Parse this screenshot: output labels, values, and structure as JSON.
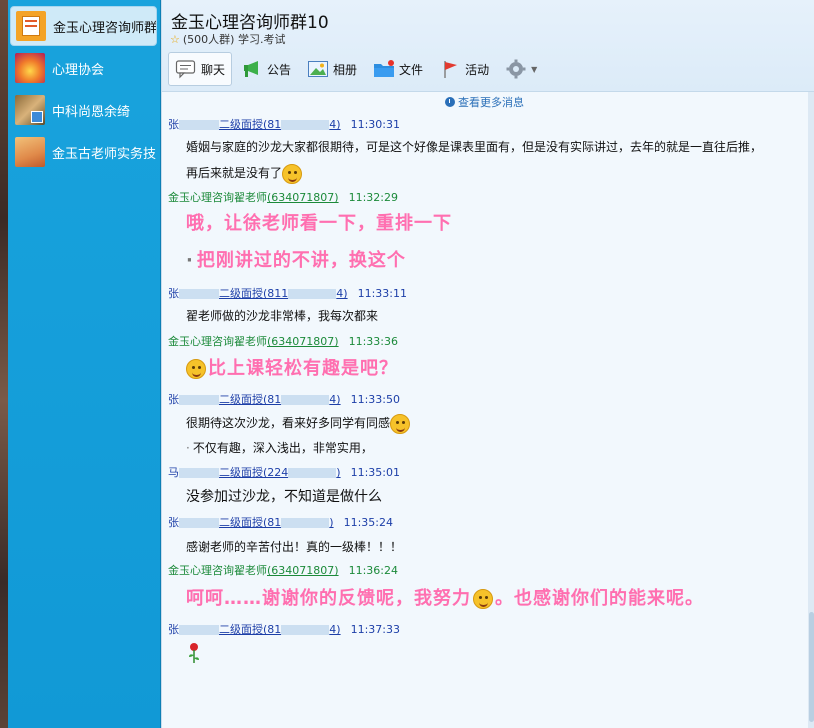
{
  "sidebar": {
    "groups": [
      {
        "name": "金玉心理咨询师群10",
        "active": true
      },
      {
        "name": "心理协会",
        "active": false
      },
      {
        "name": "中科尚恩余绮",
        "active": false
      },
      {
        "name": "金玉古老师实务技",
        "active": false
      }
    ]
  },
  "header": {
    "title": "金玉心理咨询师群10",
    "subtitle": "(500人群) 学习.考试",
    "tabs": [
      {
        "label": "聊天",
        "icon": "chat-bubble-icon"
      },
      {
        "label": "公告",
        "icon": "announcement-icon"
      },
      {
        "label": "相册",
        "icon": "photo-album-icon"
      },
      {
        "label": "文件",
        "icon": "folder-icon"
      },
      {
        "label": "活动",
        "icon": "flag-icon"
      }
    ],
    "settings_icon": "gear-icon"
  },
  "chat": {
    "more_messages": "查看更多消息",
    "messages": [
      {
        "sender_prefix": "张",
        "sender_suffix": "二级面授(81",
        "qq_tail": "4)",
        "time": "11:30:31",
        "text": "婚姻与家庭的沙龙大家都很期待，可是这个好像是课表里面有，但是没有实际讲过，去年的就是一直往后推，",
        "text2": "再后来就是没有了"
      },
      {
        "sender": "金玉心理咨询翟老师",
        "qq": "(634071807)",
        "time": "11:32:29",
        "text": "哦，让徐老师看一下，重排一下",
        "text2": "把刚讲过的不讲，换这个"
      },
      {
        "sender_prefix": "张",
        "sender_suffix": "二级面授(811",
        "qq_tail": "4)",
        "time": "11:33:11",
        "text": "翟老师做的沙龙非常棒，我每次都来"
      },
      {
        "sender": "金玉心理咨询翟老师",
        "qq": "(634071807)",
        "time": "11:33:36",
        "text": "比上课轻松有趣是吧？"
      },
      {
        "sender_prefix": "张",
        "sender_suffix": "二级面授(81",
        "qq_tail": "4)",
        "time": "11:33:50",
        "text": "很期待这次沙龙，看来好多同学有同感",
        "text2": "不仅有趣，深入浅出，非常实用，"
      },
      {
        "sender_prefix": "马",
        "sender_suffix": "二级面授(224",
        "qq_tail": ")",
        "time": "11:35:01",
        "text": "没参加过沙龙，不知道是做什么"
      },
      {
        "sender_prefix": "张",
        "sender_suffix": "二级面授(81",
        "qq_tail": ")",
        "time": "11:35:24",
        "text": "感谢老师的辛苦付出！真的一级棒！！！"
      },
      {
        "sender": "金玉心理咨询翟老师",
        "qq": "(634071807)",
        "time": "11:36:24",
        "text": "呵呵……谢谢你的反馈呢，我努力",
        "text2": "。也感谢你们的能来呢。"
      },
      {
        "sender_prefix": "张",
        "sender_suffix": "二级面授(81",
        "qq_tail": "4)",
        "time": "11:37:33",
        "icon": "rose-icon"
      }
    ]
  },
  "colors": {
    "sidebar": "#1199d6",
    "accent_pink": "#ff6fb0",
    "sender_blue": "#1d3fa8",
    "sender_green": "#1c8a3a"
  }
}
